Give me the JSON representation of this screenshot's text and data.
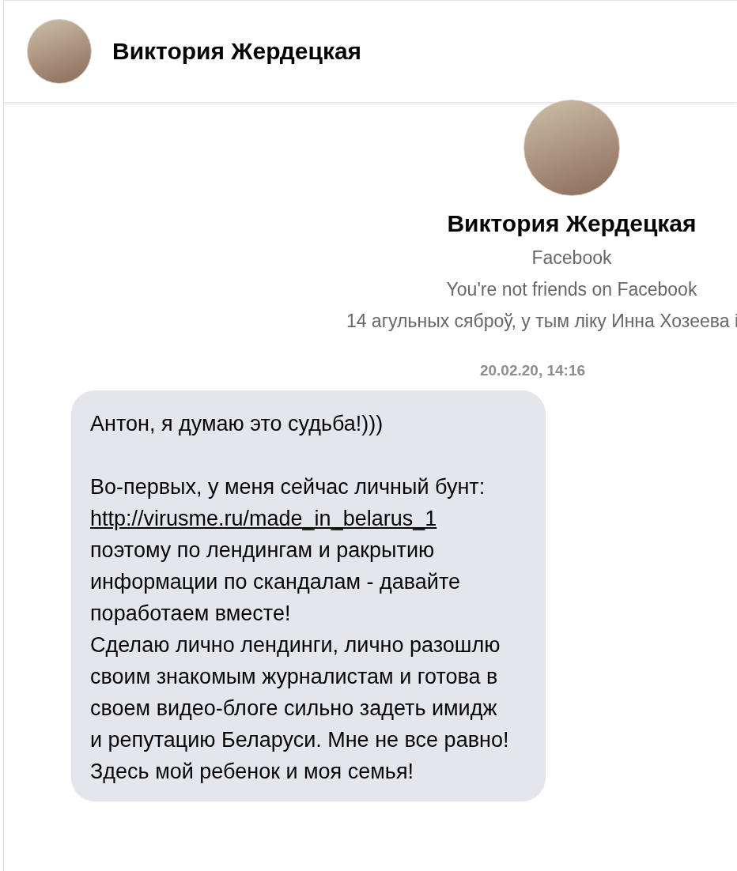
{
  "header": {
    "name": "Виктория Жердецкая"
  },
  "profile": {
    "name": "Виктория Жердецкая",
    "network": "Facebook",
    "relation": "You're not friends on Facebook",
    "mutual": "14 агульных сяброў, у тым ліку Инна Хозеева і"
  },
  "timestamp": "20.02.20, 14:16",
  "message": {
    "parts": [
      {
        "kind": "paragraph",
        "text": "Антон, я думаю это судьба!)))"
      },
      {
        "kind": "line",
        "text": "Во-первых, у меня сейчас личный бунт:"
      },
      {
        "kind": "link",
        "text": "http://virusme.ru/made_in_belarus_1"
      },
      {
        "kind": "line",
        "text": "поэтому по лендингам и ракрытию информации по скандалам - давайте поработаем вместе!"
      },
      {
        "kind": "line",
        "text": "Сделаю лично лендинги, лично разошлю своим знакомым журналистам и готова в своем видео-блоге сильно задеть имидж и репутацию Беларуси. Мне не все равно! Здесь мой ребенок и моя семья!"
      }
    ]
  }
}
